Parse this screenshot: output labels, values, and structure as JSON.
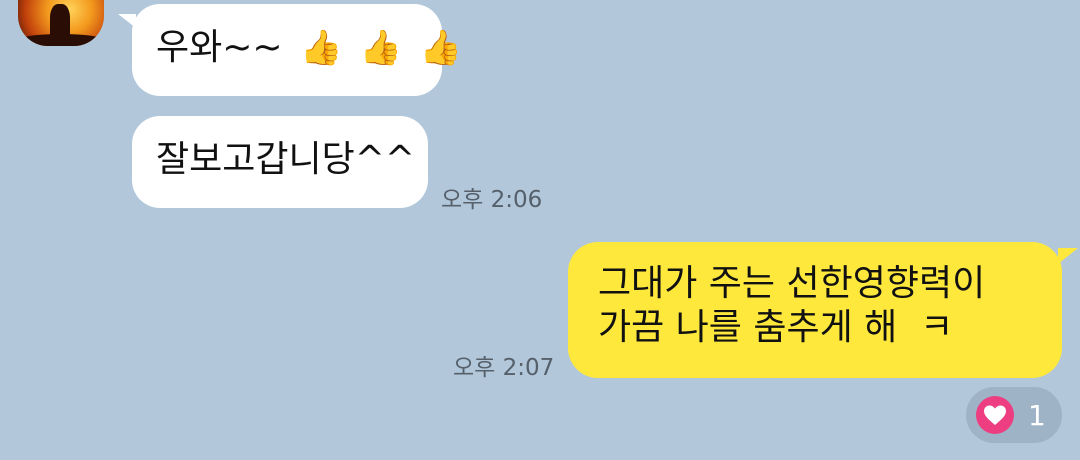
{
  "conversation": {
    "incoming": [
      {
        "text": "우와~~",
        "emoji": [
          "👍",
          "👍",
          "👍"
        ]
      },
      {
        "text": "잘보고갑니당^^",
        "time": "오후 2:06"
      }
    ],
    "outgoing": [
      {
        "line1": "그대가 주는 선한영향력이",
        "line2": "가끔 나를 춤추게 해  ㅋ",
        "time": "오후 2:07"
      }
    ]
  },
  "reaction": {
    "icon": "heart-icon",
    "count": "1"
  },
  "colors": {
    "background": "#b2c7da",
    "incoming_bubble": "#ffffff",
    "outgoing_bubble": "#fee83c",
    "reaction_heart": "#ec3e80"
  }
}
